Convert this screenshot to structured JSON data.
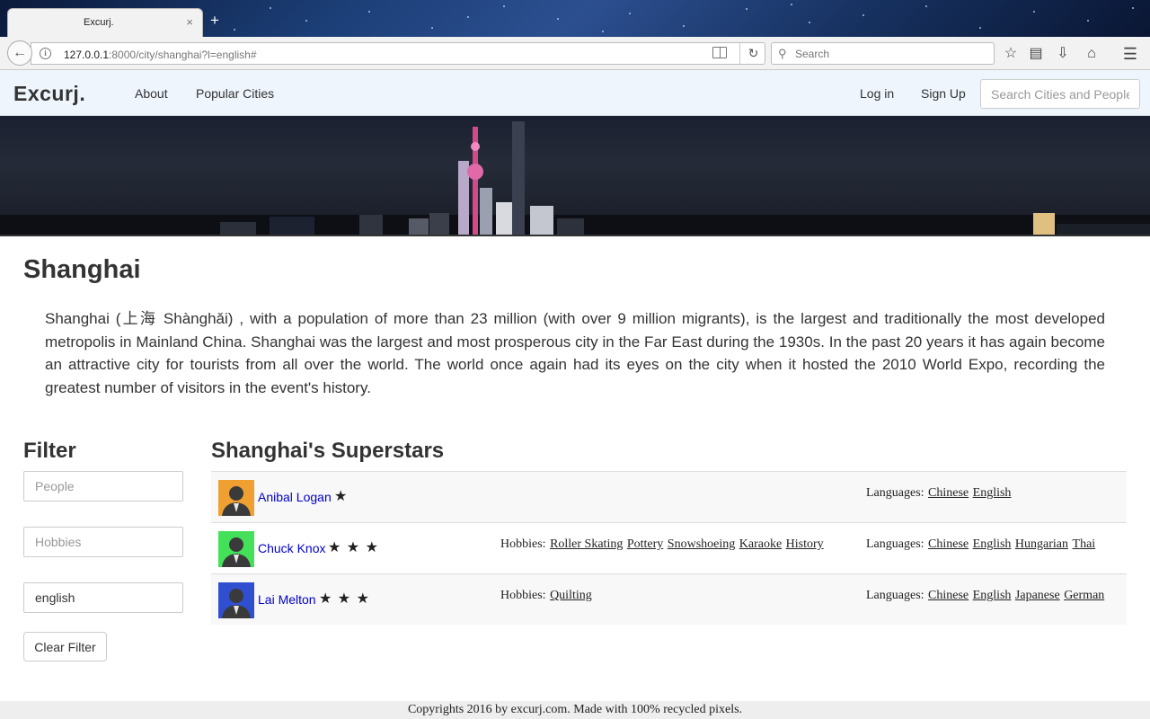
{
  "browser": {
    "tab_title": "Excurj.",
    "tab_close": "×",
    "new_tab": "+",
    "url_host": "127.0.0.1",
    "url_rest": ":8000/city/shanghai?l=english#",
    "search_placeholder": "Search",
    "icons": [
      "back-arrow-icon",
      "info-icon",
      "reader-view-icon",
      "reload-icon",
      "search-icon",
      "bookmark-star-icon",
      "reading-list-icon",
      "download-icon",
      "home-icon",
      "menu-icon"
    ]
  },
  "site": {
    "brand": "Excurj.",
    "nav": {
      "about": "About",
      "popular": "Popular Cities",
      "login": "Log in",
      "signup": "Sign Up"
    },
    "search_placeholder": "Search Cities and People"
  },
  "city": {
    "name": "Shanghai",
    "description": "Shanghai (上海 Shànghǎi) , with a population of more than 23 million (with over 9 million migrants), is the largest and traditionally the most developed metropolis in Mainland China. Shanghai was the largest and most prosperous city in the Far East during the 1930s. In the past 20 years it has again become an attractive city for tourists from all over the world. The world once again had its eyes on the city when it hosted the 2010 World Expo, recording the greatest number of visitors in the event's history."
  },
  "filter": {
    "heading": "Filter",
    "people_placeholder": "People",
    "hobbies_placeholder": "Hobbies",
    "language_value": "english",
    "clear_label": "Clear Filter"
  },
  "superstars": {
    "heading": "Shanghai's Superstars",
    "hobbies_label": "Hobbies:",
    "languages_label": "Languages:",
    "people": [
      {
        "name": "Anibal Logan",
        "stars": "★",
        "avatar_color": "#f0a030",
        "hobbies": [],
        "languages": [
          "Chinese",
          "English"
        ]
      },
      {
        "name": "Chuck Knox",
        "stars": "★ ★ ★",
        "avatar_color": "#44e05a",
        "hobbies": [
          "Roller Skating",
          "Pottery",
          "Snowshoeing",
          "Karaoke",
          "History"
        ],
        "languages": [
          "Chinese",
          "English",
          "Hungarian",
          "Thai"
        ]
      },
      {
        "name": "Lai Melton",
        "stars": "★ ★ ★",
        "avatar_color": "#2f4fd0",
        "hobbies": [
          "Quilting"
        ],
        "languages": [
          "Chinese",
          "English",
          "Japanese",
          "German"
        ]
      }
    ]
  },
  "footer": "Copyrights 2016 by excurj.com. Made with 100% recycled pixels."
}
